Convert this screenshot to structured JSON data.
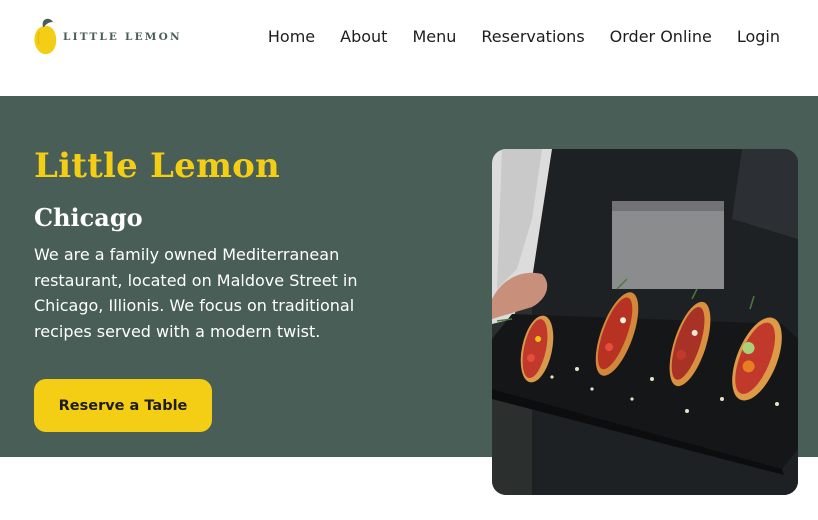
{
  "header": {
    "logo_text": "LITTLE LEMON",
    "nav": [
      {
        "label": "Home"
      },
      {
        "label": "About"
      },
      {
        "label": "Menu"
      },
      {
        "label": "Reservations"
      },
      {
        "label": "Order Online"
      },
      {
        "label": "Login"
      }
    ]
  },
  "hero": {
    "title": "Little Lemon",
    "subtitle": "Chicago",
    "description": "We are a family owned Mediterranean restaurant, located on Maldove Street in Chicago, Illionis. We focus on traditional recipes served with a modern twist.",
    "cta_label": "Reserve a Table",
    "image_alt": "Chef holding a slate of bruschetta"
  },
  "colors": {
    "primary_green": "#495e57",
    "primary_yellow": "#f4ce14",
    "text_dark": "#1d1d1d",
    "white": "#ffffff"
  },
  "icons": {
    "logo": "lemon-icon"
  }
}
